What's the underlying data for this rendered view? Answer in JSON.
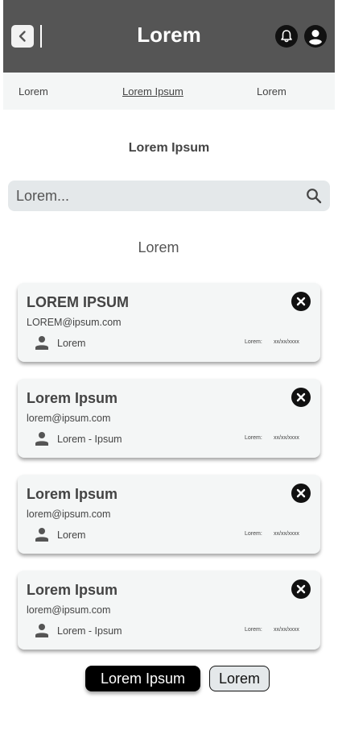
{
  "header": {
    "title": "Lorem",
    "back_icon": "chevron-left-icon",
    "notification_icon": "bell-icon",
    "account_icon": "account-circle-icon",
    "background": "#555555"
  },
  "tabs": [
    {
      "label": "Lorem",
      "active": false
    },
    {
      "label": "Lorem Ipsum",
      "active": true
    },
    {
      "label": "Lorem",
      "active": false
    }
  ],
  "section_title": "Lorem Ipsum",
  "search": {
    "placeholder": "Lorem...",
    "value": "",
    "icon": "search-icon"
  },
  "subheading": "Lorem",
  "cards": [
    {
      "name": "LOREM IPSUM",
      "email": "LOREM@ipsum.com",
      "role": "Lorem",
      "date_label": "Lorem:",
      "date": "xx/xx/xxxx"
    },
    {
      "name": "Lorem Ipsum",
      "email": "lorem@ipsum.com",
      "role": "Lorem - Ipsum",
      "date_label": "Lorem:",
      "date": "xx/xx/xxxx"
    },
    {
      "name": "Lorem Ipsum",
      "email": "lorem@ipsum.com",
      "role": "Lorem",
      "date_label": "Lorem:",
      "date": "xx/xx/xxxx"
    },
    {
      "name": "Lorem Ipsum",
      "email": "lorem@ipsum.com",
      "role": "Lorem - Ipsum",
      "date_label": "Lorem:",
      "date": "xx/xx/xxxx"
    }
  ],
  "buttons": {
    "primary": "Lorem Ipsum",
    "secondary": "Lorem"
  }
}
